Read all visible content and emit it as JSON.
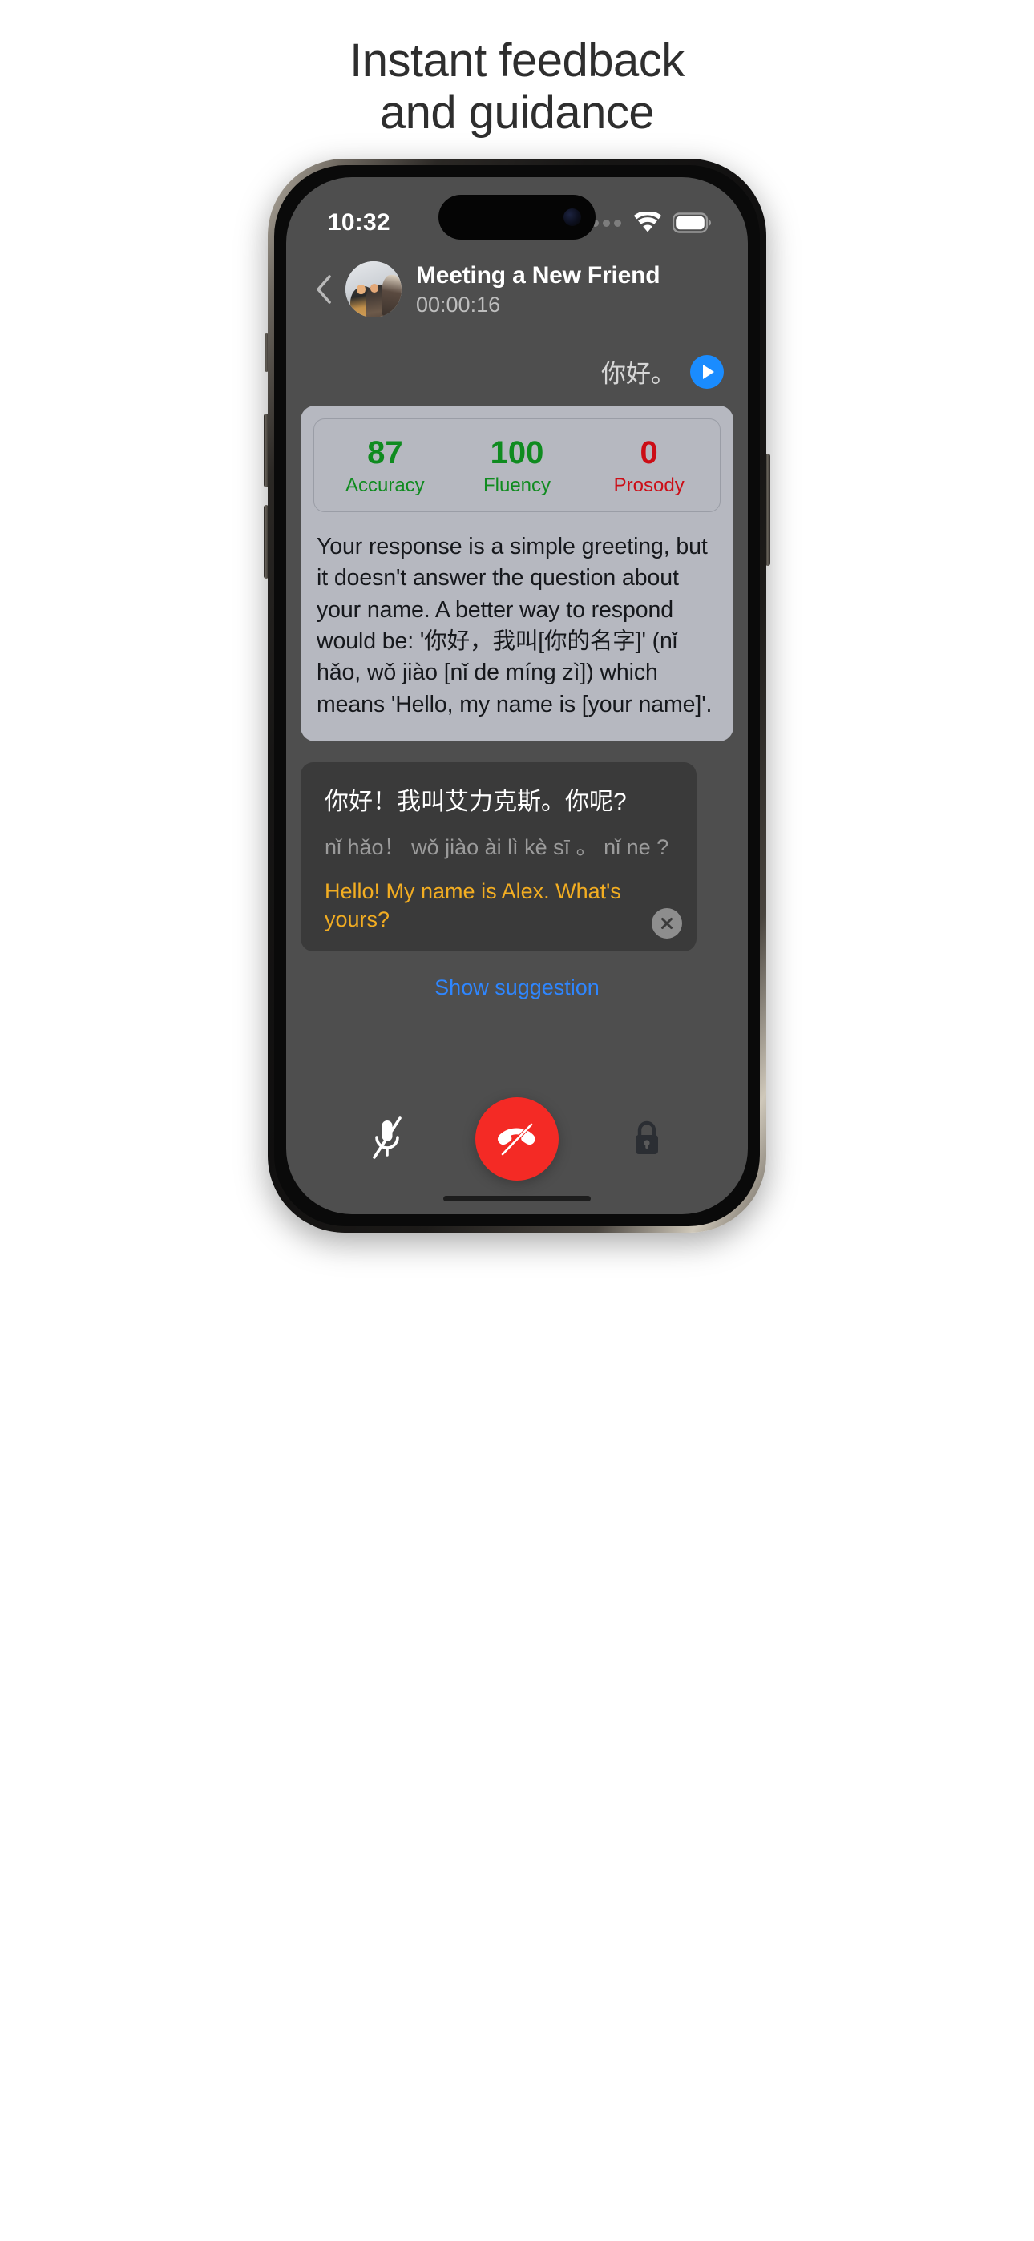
{
  "promo": {
    "line1": "Instant feedback",
    "line2": "and guidance"
  },
  "status_bar": {
    "time": "10:32",
    "cellular_icon": "cellular-dots-icon",
    "wifi_icon": "wifi-icon",
    "battery_icon": "battery-full-icon"
  },
  "header": {
    "back_icon": "chevron-left-icon",
    "avatar": "conversation-avatar",
    "title": "Meeting a New Friend",
    "timer": "00:00:16"
  },
  "user_message": {
    "text": "你好。",
    "play_icon": "play-icon"
  },
  "feedback": {
    "scores": [
      {
        "value": "87",
        "label": "Accuracy",
        "color": "#0f8b1f"
      },
      {
        "value": "100",
        "label": "Fluency",
        "color": "#0f8b1f"
      },
      {
        "value": "0",
        "label": "Prosody",
        "color": "#cc0d16"
      }
    ],
    "text": "Your response is a simple greeting, but it doesn't answer the question about your name. A better way to respond would be: '你好，我叫[你的名字]' (nǐ hǎo, wǒ jiào [nǐ de míng zì]) which means 'Hello, my name is [your name]'."
  },
  "ai_message": {
    "hanzi": "你好！我叫艾力克斯。你呢?",
    "pinyin": "nǐ hǎo！ wǒ jiào ài lì kè sī 。 nǐ ne ?",
    "translation": "Hello! My name is Alex. What's yours?",
    "close_icon": "close-circle-icon"
  },
  "suggestion_link": "Show suggestion",
  "controls": {
    "mic_icon": "mic-off-icon",
    "end_call_icon": "phone-hangup-icon",
    "lock_icon": "lock-icon",
    "end_call_color": "#f42a25"
  }
}
